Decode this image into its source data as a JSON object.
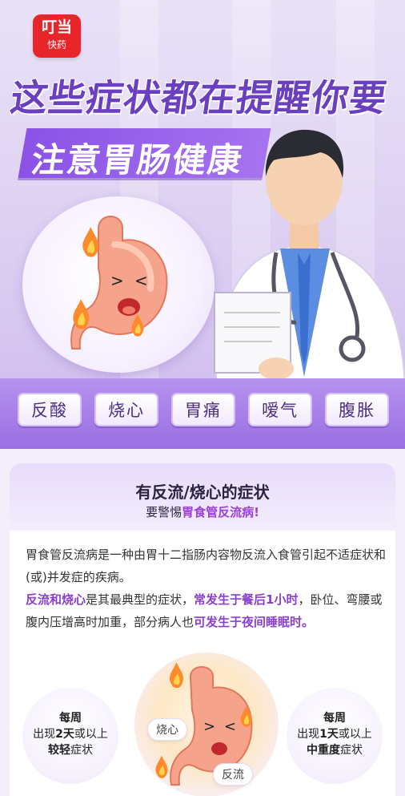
{
  "logo": {
    "line1": "叮当",
    "line2": "快药"
  },
  "hero": {
    "title_line1": "这些症状都在提醒你要",
    "title_line2": "注意胃肠健康"
  },
  "symptoms": [
    "反酸",
    "烧心",
    "胃痛",
    "嗳气",
    "腹胀"
  ],
  "card": {
    "title": "有反流/烧心的症状",
    "subtitle_prefix": "要警惕",
    "subtitle_highlight": "胃食管反流病!",
    "para1": "胃食管反流病是一种由胃十二指肠内容物反流入食管引起不适症状和(或)并发症的疾病。",
    "para2": {
      "hl1": "反流和烧心",
      "t1": "是其最典型的症状，",
      "hl2": "常发生于餐后1小时",
      "t2": "，卧位、弯腰或腹内压增高时加重，部分病人也",
      "hl3": "可发生于夜间睡眠时。"
    },
    "stat_left": {
      "l1": "每周",
      "l2a": "出现",
      "l2b": "2天",
      "l2c": "或以上",
      "l3a": "较轻",
      "l3b": "症状"
    },
    "stat_right": {
      "l1": "每周",
      "l2a": "出现",
      "l2b": "1天",
      "l2c": "或以上",
      "l3a": "中重度",
      "l3b": "症状"
    },
    "tag_left": "烧心",
    "tag_right": "反流"
  },
  "colors": {
    "brand_red": "#e8262a",
    "purple": "#8a52e6",
    "highlight": "#8a3fd0"
  }
}
